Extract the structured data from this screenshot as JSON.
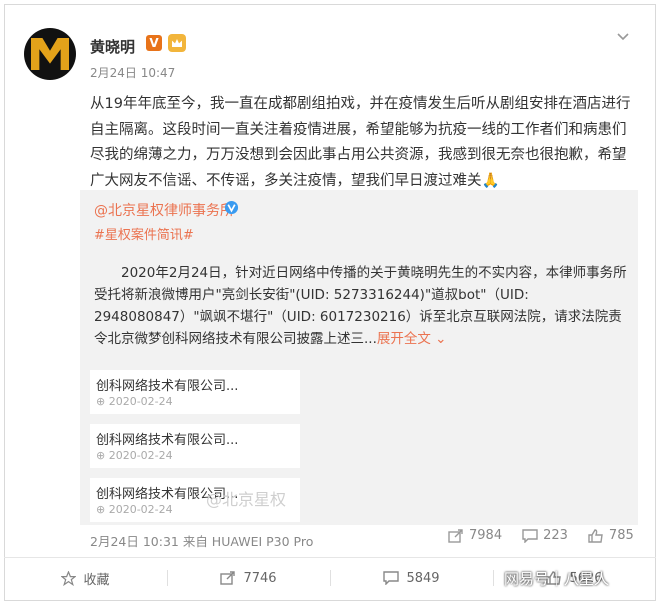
{
  "post": {
    "author": "黄晓明",
    "verified_badge": "V",
    "timestamp": "2月24日 10:47",
    "content": "从19年年底至今，我一直在成都剧组拍戏，并在疫情发生后听从剧组安排在酒店进行自主隔离。这段时间一直关注着疫情进展，希望能够为抗疫一线的工作者们和病患们尽我的绵薄之力，万万没想到会因此事占用公共资源，我感到很无奈也很抱歉，希望广大网友不信谣、不传谣，多关注疫情，望我们早日渡过难关🙏"
  },
  "repost": {
    "author": "@北京星权律师事务所",
    "tag": "#星权案件简讯#",
    "text": "2020年2月24日，针对近日网络中传播的关于黄晓明先生的不实内容，本律师事务所受托将新浪微博用户\"亮剑长安街\"(UID: 5273316244)\"道叔bot\"（UID: 2948080847）\"飒飒不堪行\"（UID: 6017230216）诉至北京互联网法院，请求法院责令北京微梦创科网络技术有限公司披露上述三...",
    "expand_label": "展开全文",
    "link_cards": [
      {
        "title": "创科网络技术有限公司...",
        "date": "2020-02-24"
      },
      {
        "title": "创科网络技术有限公司...",
        "date": "2020-02-24"
      },
      {
        "title": "创科网络技术有限公司...",
        "date": "2020-02-24"
      }
    ],
    "watermark": "@北京星权",
    "meta": "2月24日 10:31 来自 HUAWEI P30 Pro",
    "stats": {
      "reposts": "7984",
      "comments": "223",
      "likes": "785"
    }
  },
  "footer": {
    "favorite_label": "收藏",
    "repost_count": "7746",
    "comment_count": "5849",
    "like_count": "5626"
  },
  "source_watermark": "网易号｜八星人",
  "colors": {
    "accent": "#eb7350",
    "repost_bg": "#f2f2f2",
    "badge": "#e8731a"
  }
}
